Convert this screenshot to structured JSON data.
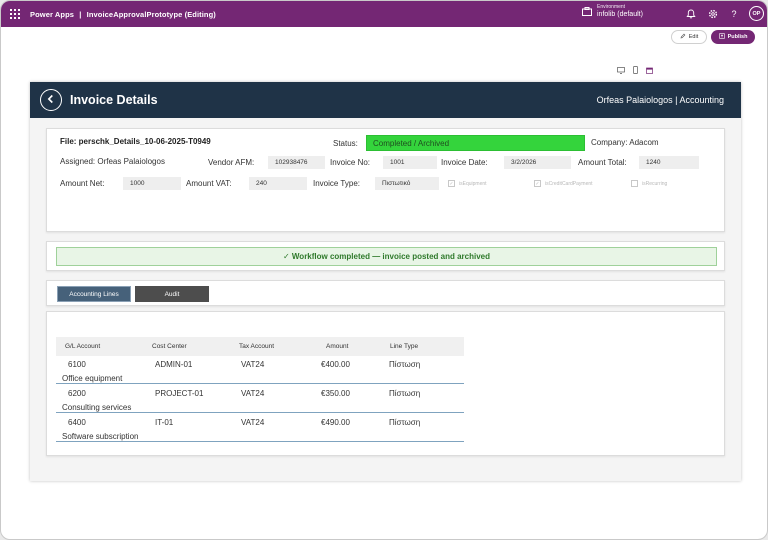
{
  "topbar": {
    "app_name": "Power Apps",
    "separator": "|",
    "app_title": "InvoiceApprovalPrototype (Editing)",
    "environment_label": "Environment",
    "environment_value": "infolib (default)",
    "avatar_initials": "OP"
  },
  "commandbar": {
    "edit_label": "Edit",
    "publish_label": "Publish"
  },
  "header": {
    "title": "Invoice Details",
    "user_dept": "Orfeas Palaiologos | Accounting"
  },
  "details": {
    "file_label": "File: perschk_Details_10-06-2025-T0949",
    "status_label": "Status:",
    "status_value": "Completed / Archived",
    "company_label": "Company: Adacom",
    "assigned_label": "Assigned: Orfeas Palaiologos",
    "vendor_afm_label": "Vendor AFM:",
    "vendor_afm_value": "102938476",
    "invoice_no_label": "Invoice No:",
    "invoice_no_value": "1001",
    "invoice_date_label": "Invoice Date:",
    "invoice_date_value": "3/2/2026",
    "amount_total_label": "Amount Total:",
    "amount_total_value": "1240",
    "amount_net_label": "Amount Net:",
    "amount_net_value": "1000",
    "amount_vat_label": "Amount VAT:",
    "amount_vat_value": "240",
    "invoice_type_label": "Invoice Type:",
    "invoice_type_value": "Πιστωτικό",
    "checkboxes": [
      {
        "label": "isEquipment",
        "checked": true
      },
      {
        "label": "isCreditCardPayment",
        "checked": true
      },
      {
        "label": "isRecurring",
        "checked": false
      }
    ]
  },
  "banner": {
    "text": "✓ Workflow completed — invoice posted and archived"
  },
  "tabs": {
    "accounting_lines": "Accounting Lines",
    "audit": "Audit"
  },
  "grid": {
    "headers": [
      "G/L Account",
      "Cost Center",
      "Tax Account",
      "Amount",
      "Line Type"
    ],
    "rows": [
      {
        "gl": "6100",
        "cost_center": "ADMIN-01",
        "tax": "VAT24",
        "amount": "€400.00",
        "line_type": "Πίστωση",
        "description": "Office equipment"
      },
      {
        "gl": "6200",
        "cost_center": "PROJECT-01",
        "tax": "VAT24",
        "amount": "€350.00",
        "line_type": "Πίστωση",
        "description": "Consulting services"
      },
      {
        "gl": "6400",
        "cost_center": "IT-01",
        "tax": "VAT24",
        "amount": "€490.00",
        "line_type": "Πίστωση",
        "description": "Software subscription"
      }
    ]
  },
  "colors": {
    "brand": "#742774",
    "header": "#1f3347",
    "status_green": "#34d43c",
    "tab_active": "#46617a",
    "tab_inactive": "#4d4d4d"
  }
}
